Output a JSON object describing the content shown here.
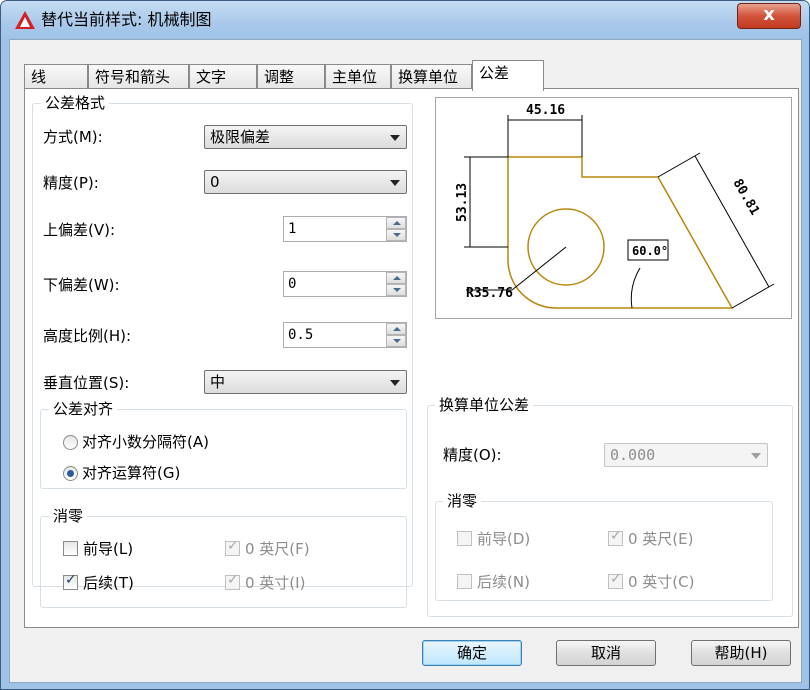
{
  "window": {
    "title": "替代当前样式: 机械制图",
    "close_label": "x"
  },
  "tabs": [
    {
      "label": "线"
    },
    {
      "label": "符号和箭头"
    },
    {
      "label": "文字"
    },
    {
      "label": "调整"
    },
    {
      "label": "主单位"
    },
    {
      "label": "换算单位"
    },
    {
      "label": "公差"
    }
  ],
  "tolerance_format": {
    "group_label": "公差格式",
    "method_label": "方式(M):",
    "method_value": "极限偏差",
    "precision_label": "精度(P):",
    "precision_value": "0",
    "upper_label": "上偏差(V):",
    "upper_value": "1",
    "lower_label": "下偏差(W):",
    "lower_value": "0",
    "height_label": "高度比例(H):",
    "height_value": "0.5",
    "vertical_label": "垂直位置(S):",
    "vertical_value": "中"
  },
  "alignment": {
    "group_label": "公差对齐",
    "option1": "对齐小数分隔符(A)",
    "option2": "对齐运算符(G)"
  },
  "zero_suppression": {
    "group_label": "消零",
    "leading": "前导(L)",
    "trailing": "后续(T)",
    "feet": "0 英尺(F)",
    "inches": "0 英寸(I)"
  },
  "alt_units": {
    "group_label": "换算单位公差",
    "precision_label": "精度(O):",
    "precision_value": "0.000",
    "zero_group_label": "消零",
    "leading": "前导(D)",
    "trailing": "后续(N)",
    "feet": "0 英尺(E)",
    "inches": "0 英寸(C)"
  },
  "preview": {
    "dim_top": "45.16",
    "dim_left": "53.13",
    "dim_angle": "60.0°",
    "dim_diag": "80.81",
    "dim_radius": "R35.76"
  },
  "buttons": {
    "ok": "确定",
    "cancel": "取消",
    "help": "帮助(H)"
  },
  "colors": {
    "preview_shape": "#b8860b",
    "dim_line": "#000000",
    "accent": "#3c7fb1"
  }
}
